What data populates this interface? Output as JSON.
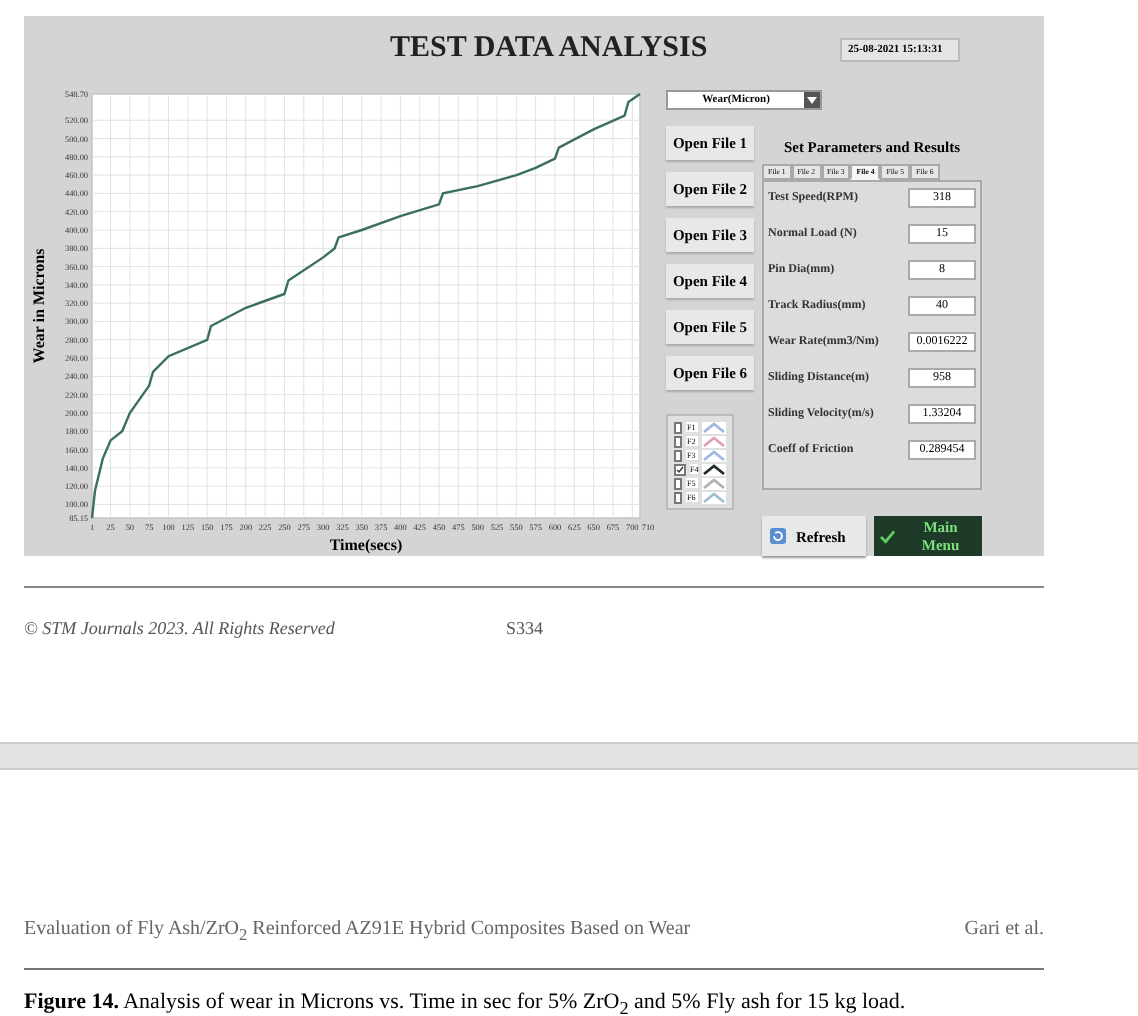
{
  "app": {
    "title": "TEST DATA ANALYSIS",
    "datetime": "25-08-2021 15:13:31",
    "chart": {
      "chart_data": {
        "type": "line",
        "grid": true,
        "xlabel": "Time(secs)",
        "ylabel": "Wear in Microns",
        "xlim": [
          1,
          710
        ],
        "ylim": [
          85.15,
          548.7
        ],
        "xticks": [
          1,
          25,
          50,
          75,
          100,
          125,
          150,
          175,
          200,
          225,
          250,
          275,
          300,
          325,
          350,
          375,
          400,
          425,
          450,
          475,
          500,
          525,
          550,
          575,
          600,
          625,
          650,
          675,
          700,
          710
        ],
        "yticks": [
          {
            "value": 85.15,
            "label": "85.15"
          },
          {
            "value": 100,
            "label": "100.00"
          },
          {
            "value": 120,
            "label": "120.00"
          },
          {
            "value": 140,
            "label": "140.00"
          },
          {
            "value": 160,
            "label": "160.00"
          },
          {
            "value": 180,
            "label": "180.00"
          },
          {
            "value": 200,
            "label": "200.00"
          },
          {
            "value": 220,
            "label": "220.00"
          },
          {
            "value": 240,
            "label": "240.00"
          },
          {
            "value": 260,
            "label": "260.00"
          },
          {
            "value": 280,
            "label": "280.00"
          },
          {
            "value": 300,
            "label": "300.00"
          },
          {
            "value": 320,
            "label": "320.00"
          },
          {
            "value": 340,
            "label": "340.00"
          },
          {
            "value": 360,
            "label": "360.00"
          },
          {
            "value": 380,
            "label": "380.00"
          },
          {
            "value": 400,
            "label": "400.00"
          },
          {
            "value": 420,
            "label": "420.00"
          },
          {
            "value": 440,
            "label": "440.00"
          },
          {
            "value": 460,
            "label": "460.00"
          },
          {
            "value": 480,
            "label": "480.00"
          },
          {
            "value": 500,
            "label": "500.00"
          },
          {
            "value": 520,
            "label": "520.00"
          },
          {
            "value": 548.7,
            "label": "548.70"
          }
        ],
        "x": [
          1,
          5,
          15,
          25,
          40,
          50,
          75,
          80,
          100,
          150,
          155,
          200,
          250,
          255,
          300,
          315,
          320,
          350,
          400,
          450,
          455,
          500,
          550,
          575,
          600,
          605,
          650,
          690,
          695,
          710
        ],
        "series": [
          {
            "color": "#3a6e60",
            "values": [
              85.2,
              115,
              150,
              170,
              180,
              200,
              230,
              245,
              262,
              280,
              295,
              315,
              330,
              345,
              370,
              380,
              392,
              400,
              415,
              428,
              440,
              448,
              460,
              468,
              478,
              490,
              510,
              525,
              540,
              548.7
            ]
          }
        ]
      }
    },
    "dropdown": {
      "value": "Wear(Micron)"
    },
    "open_buttons": [
      "Open File 1",
      "Open File 2",
      "Open File 3",
      "Open File 4",
      "Open File 5",
      "Open File 6"
    ],
    "panel_title": "Set Parameters and  Results",
    "tabs": [
      {
        "label": "File 1",
        "selected": false
      },
      {
        "label": "File 2",
        "selected": false
      },
      {
        "label": "File 3",
        "selected": false
      },
      {
        "label": "File 4",
        "selected": true
      },
      {
        "label": "File 5",
        "selected": false
      },
      {
        "label": "File 6",
        "selected": false
      }
    ],
    "params": [
      {
        "label": "Test Speed(RPM)",
        "value": "318"
      },
      {
        "label": "Normal Load (N)",
        "value": "15"
      },
      {
        "label": "Pin Dia(mm)",
        "value": "8"
      },
      {
        "label": "Track Radius(mm)",
        "value": "40"
      },
      {
        "label": "Wear Rate(mm3/Nm)",
        "value": "0.0016222"
      },
      {
        "label": "Sliding Distance(m)",
        "value": "958"
      },
      {
        "label": "Sliding Velocity(m/s)",
        "value": "1.33204"
      },
      {
        "label": "Coeff of Friction",
        "value": "0.289454"
      }
    ],
    "legend": [
      {
        "label": "F1",
        "checked": false,
        "color": "#9fb6e0"
      },
      {
        "label": "F2",
        "checked": false,
        "color": "#e0a0b4"
      },
      {
        "label": "F3",
        "checked": false,
        "color": "#9fb6e0"
      },
      {
        "label": "F4",
        "checked": true,
        "color": "#1e2e2e"
      },
      {
        "label": "F5",
        "checked": false,
        "color": "#b0b0b0"
      },
      {
        "label": "F6",
        "checked": false,
        "color": "#a0c0d0"
      }
    ],
    "refresh_button": "Refresh",
    "main_menu_button": "Main Menu"
  },
  "footer": {
    "copyright": "© STM Journals 2023. All Rights Reserved",
    "page": "S334"
  },
  "header": {
    "title": "Evaluation of Fly Ash/ZrO$_{2}$ Reinforced AZ91E Hybrid Composites Based on Wear",
    "authors": "Gari et al."
  },
  "caption": "**Figure 14.** Analysis of wear in Microns vs. Time in sec for 5% ZrO$_{2}$ and 5% Fly ash for 15 kg load."
}
